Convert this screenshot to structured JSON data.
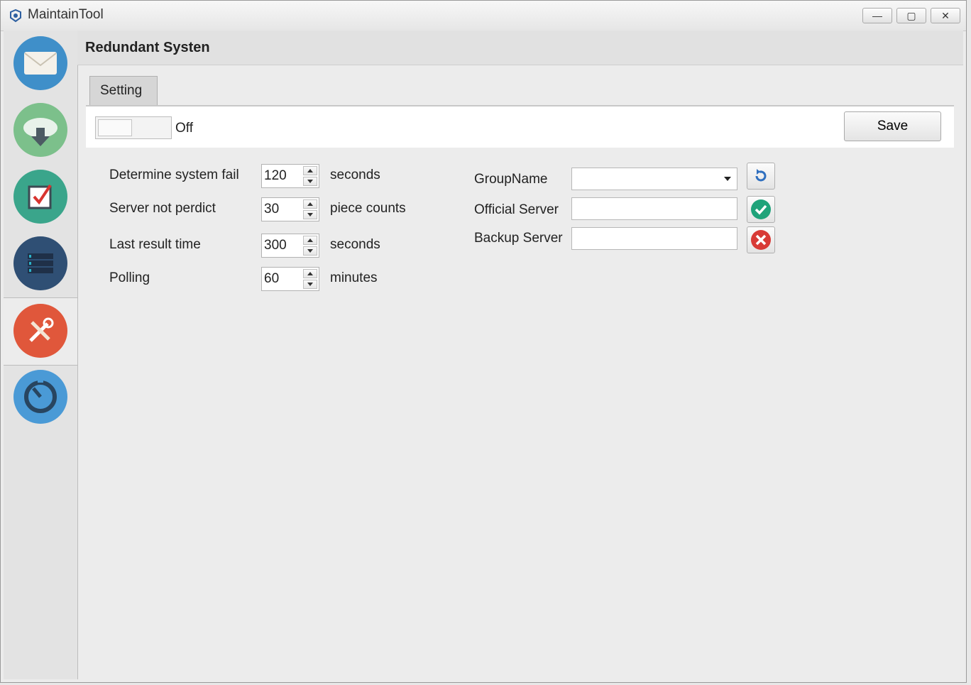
{
  "window": {
    "title": "MaintainTool",
    "controls": {
      "minimize": "—",
      "maximize": "▢",
      "close": "✕"
    }
  },
  "sidebar": {
    "items": [
      {
        "icon": "envelope-icon",
        "color": "#3f8fc9",
        "active": false
      },
      {
        "icon": "cloud-download-icon",
        "color": "#7cc08b",
        "active": false
      },
      {
        "icon": "checkbox-icon",
        "color": "#3aa58b",
        "active": false
      },
      {
        "icon": "server-list-icon",
        "color": "#2f4f74",
        "active": false
      },
      {
        "icon": "tools-icon",
        "color": "#e0573b",
        "active": true
      },
      {
        "icon": "timer-icon",
        "color": "#4a9ad6",
        "active": false
      }
    ]
  },
  "header": {
    "title": "Redundant Systen"
  },
  "tabs": [
    {
      "label": "Setting",
      "active": true
    }
  ],
  "toggle": {
    "state_label": "Off"
  },
  "toolbar": {
    "save_label": "Save"
  },
  "settings": {
    "rows": [
      {
        "label": "Determine system fail",
        "value": "120",
        "unit": "seconds"
      },
      {
        "label": "Server not perdict",
        "value": "30",
        "unit": "piece counts"
      },
      {
        "label": "Last result time",
        "value": "300",
        "unit": "seconds"
      },
      {
        "label": "Polling",
        "value": "60",
        "unit": "minutes"
      }
    ]
  },
  "servers": {
    "group_label": "GroupName",
    "group_value": "",
    "official_label": "Official Server",
    "official_value": "",
    "backup_label": "Backup Server",
    "backup_value": ""
  },
  "colors": {
    "refresh": "#2f6fbf",
    "confirm": "#1fa37a",
    "delete": "#d83a36"
  }
}
